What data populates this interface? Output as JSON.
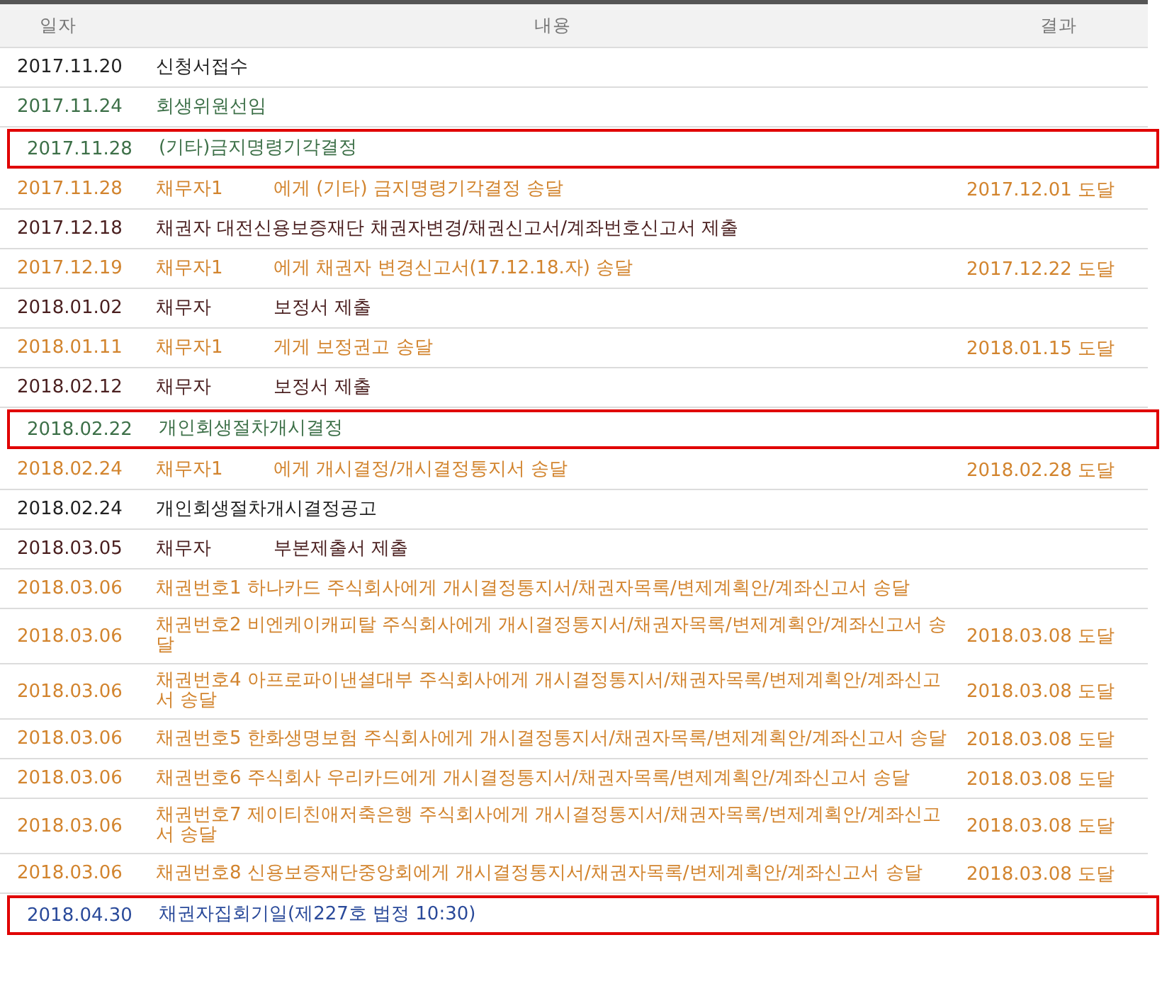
{
  "table": {
    "columns": [
      "일자",
      "내용",
      "결과"
    ],
    "rows": [
      {
        "date": "2017.11.20",
        "content": "신청서접수",
        "color": "#222222",
        "highlighted": false
      },
      {
        "date": "2017.11.24",
        "content": "회생위원선임",
        "color": "#3d7048",
        "highlighted": false
      },
      {
        "date": "2017.11.28",
        "content": "(기타)금지명령기각결정",
        "color": "#3d7048",
        "highlighted": true
      },
      {
        "date": "2017.11.28",
        "party": "채무자1",
        "content": "에게 (기타) 금지명령기각결정 송달",
        "result": "2017.12.01 도달",
        "color": "#d2842e",
        "highlighted": false
      },
      {
        "date": "2017.12.18",
        "content": "채권자 대전신용보증재단 채권자변경/채권신고서/계좌번호신고서 제출",
        "color": "#4a1f1f",
        "highlighted": false
      },
      {
        "date": "2017.12.19",
        "party": "채무자1",
        "content": "에게 채권자 변경신고서(17.12.18.자) 송달",
        "result": "2017.12.22 도달",
        "color": "#d2842e",
        "highlighted": false
      },
      {
        "date": "2018.01.02",
        "party": "채무자",
        "content": "보정서 제출",
        "color": "#4a1f1f",
        "highlighted": false
      },
      {
        "date": "2018.01.11",
        "party": "채무자1",
        "content": "게게 보정권고 송달",
        "result": "2018.01.15 도달",
        "color": "#d2842e",
        "highlighted": false
      },
      {
        "date": "2018.02.12",
        "party": "채무자",
        "content": "보정서 제출",
        "color": "#4a1f1f",
        "highlighted": false
      },
      {
        "date": "2018.02.22",
        "content": "개인회생절차개시결정",
        "color": "#3d7048",
        "highlighted": true
      },
      {
        "date": "2018.02.24",
        "party": "채무자1",
        "content": "에게 개시결정/개시결정통지서 송달",
        "result": "2018.02.28 도달",
        "color": "#d2842e",
        "highlighted": false
      },
      {
        "date": "2018.02.24",
        "content": "개인회생절차개시결정공고",
        "color": "#222222",
        "highlighted": false
      },
      {
        "date": "2018.03.05",
        "party": "채무자",
        "content": "부본제출서 제출",
        "color": "#4a1f1f",
        "highlighted": false
      },
      {
        "date": "2018.03.06",
        "content": "채권번호1 하나카드 주식회사에게 개시결정통지서/채권자목록/변제계획안/계좌신고서 송달",
        "color": "#d2842e",
        "highlighted": false
      },
      {
        "date": "2018.03.06",
        "content": "채권번호2 비엔케이캐피탈 주식회사에게 개시결정통지서/채권자목록/변제계획안/계좌신고서 송달",
        "result": "2018.03.08 도달",
        "color": "#d2842e",
        "highlighted": false
      },
      {
        "date": "2018.03.06",
        "content": "채권번호4 아프로파이낸셜대부 주식회사에게 개시결정통지서/채권자목록/변제계획안/계좌신고서 송달",
        "result": "2018.03.08 도달",
        "color": "#d2842e",
        "highlighted": false
      },
      {
        "date": "2018.03.06",
        "content": "채권번호5 한화생명보험 주식회사에게 개시결정통지서/채권자목록/변제계획안/계좌신고서 송달",
        "result": "2018.03.08 도달",
        "color": "#d2842e",
        "highlighted": false
      },
      {
        "date": "2018.03.06",
        "content": "채권번호6 주식회사 우리카드에게 개시결정통지서/채권자목록/변제계획안/계좌신고서 송달",
        "result": "2018.03.08 도달",
        "color": "#d2842e",
        "highlighted": false
      },
      {
        "date": "2018.03.06",
        "content": "채권번호7 제이티친애저축은행 주식회사에게 개시결정통지서/채권자목록/변제계획안/계좌신고서 송달",
        "result": "2018.03.08 도달",
        "color": "#d2842e",
        "highlighted": false
      },
      {
        "date": "2018.03.06",
        "content": "채권번호8 신용보증재단중앙회에게 개시결정통지서/채권자목록/변제계획안/계좌신고서 송달",
        "result": "2018.03.08 도달",
        "color": "#d2842e",
        "highlighted": false
      },
      {
        "date": "2018.04.30",
        "content": "채권자집회기일(제227호 법정 10:30)",
        "color": "#2a4a9a",
        "highlighted": true
      }
    ]
  }
}
